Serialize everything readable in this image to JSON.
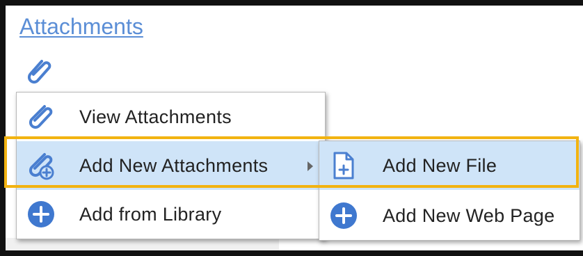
{
  "title_link": "Attachments",
  "main_menu": {
    "items": [
      {
        "label": "View Attachments",
        "icon": "paperclip-icon"
      },
      {
        "label": "Add New Attachments",
        "icon": "paperclip-add-icon",
        "has_submenu": true
      },
      {
        "label": "Add from Library",
        "icon": "plus-circle-icon"
      }
    ]
  },
  "sub_menu": {
    "items": [
      {
        "label": "Add New File",
        "icon": "file-add-icon"
      },
      {
        "label": "Add New Web Page",
        "icon": "plus-circle-icon"
      }
    ]
  },
  "colors": {
    "accent": "#4a7fd0",
    "highlight_bg": "#cfe4f8",
    "focus_outline": "#f2b311"
  }
}
